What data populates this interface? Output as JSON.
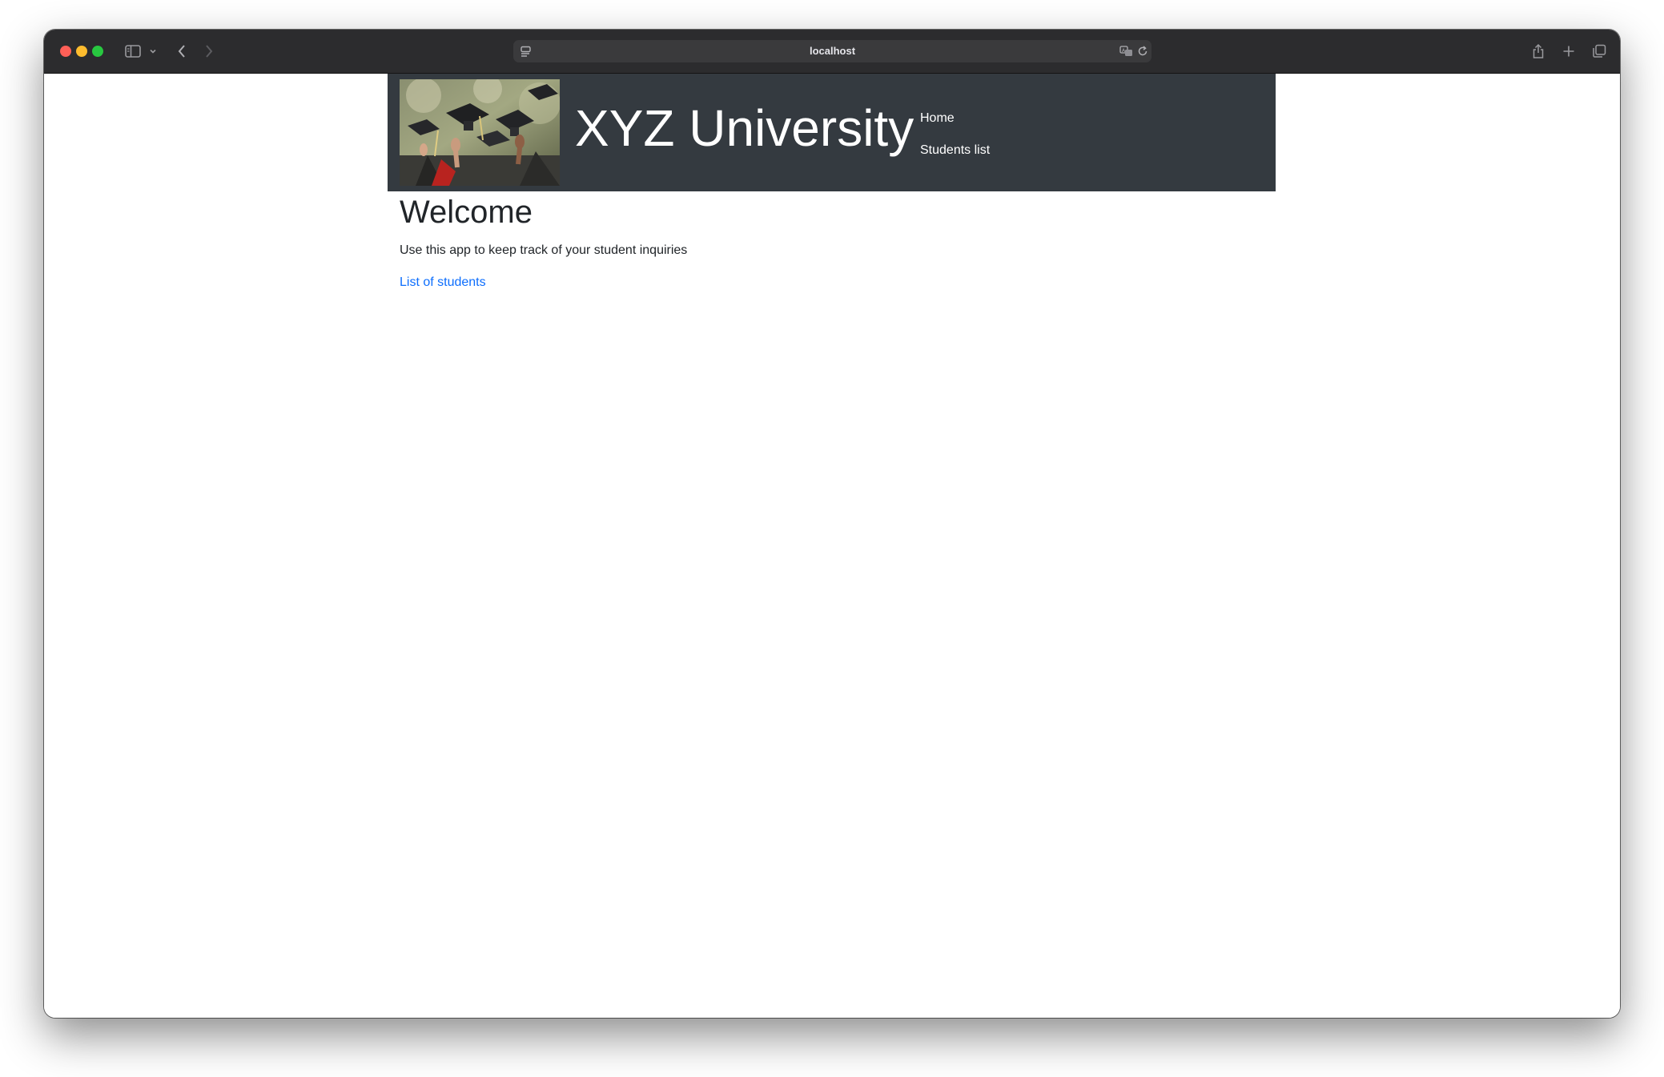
{
  "browser": {
    "address": "localhost",
    "icons": {
      "sidebar": "sidebar-icon",
      "chevron": "chevron-down-icon",
      "back": "back-arrow-icon",
      "forward": "forward-arrow-icon",
      "page_menu": "page-menu-icon",
      "translate": "translate-icon",
      "reload": "reload-icon",
      "share": "share-icon",
      "new_tab": "plus-icon",
      "tabs_overview": "tabs-overview-icon"
    },
    "colors": {
      "titlebar": "#2c2c2e",
      "close": "#fe5f57",
      "minimize": "#febc2e",
      "maximize": "#28c840"
    }
  },
  "header": {
    "title": "XYZ University",
    "image": "graduation-caps-photo",
    "background": "#343a40",
    "nav": [
      {
        "label": "Home"
      },
      {
        "label": "Students list"
      }
    ]
  },
  "main": {
    "heading": "Welcome",
    "intro": "Use this app to keep track of your student inquiries",
    "link": "List of students",
    "link_color": "#0d6efd"
  }
}
